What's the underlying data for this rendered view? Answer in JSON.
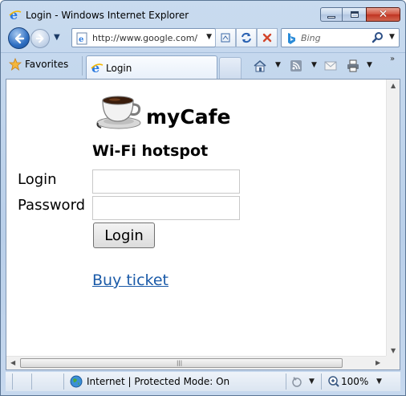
{
  "window": {
    "title": "Login - Windows Internet Explorer"
  },
  "nav": {
    "address": "http://www.google.com/",
    "search_placeholder": "Bing"
  },
  "command_bar": {
    "favorites_label": "Favorites",
    "tab_label": "Login"
  },
  "page": {
    "brand": "myCafe",
    "subtitle": "Wi-Fi hotspot",
    "login_label": "Login",
    "password_label": "Password",
    "login_value": "",
    "password_value": "",
    "login_button": "Login",
    "buy_link": "Buy ticket"
  },
  "status": {
    "zone": "Internet | Protected Mode: On",
    "zoom": "100%"
  },
  "colors": {
    "link": "#1a5aa8",
    "chrome": "#c9dbef",
    "close_button": "#c03422"
  },
  "icons": [
    "ie-logo-icon",
    "back-arrow-icon",
    "forward-arrow-icon",
    "compatibility-icon",
    "refresh-icon",
    "stop-icon",
    "bing-logo-icon",
    "search-icon",
    "favorites-star-icon",
    "home-icon",
    "rss-feed-icon",
    "read-mail-icon",
    "print-icon",
    "coffee-cup-icon",
    "globe-icon",
    "security-icon",
    "zoom-icon"
  ]
}
